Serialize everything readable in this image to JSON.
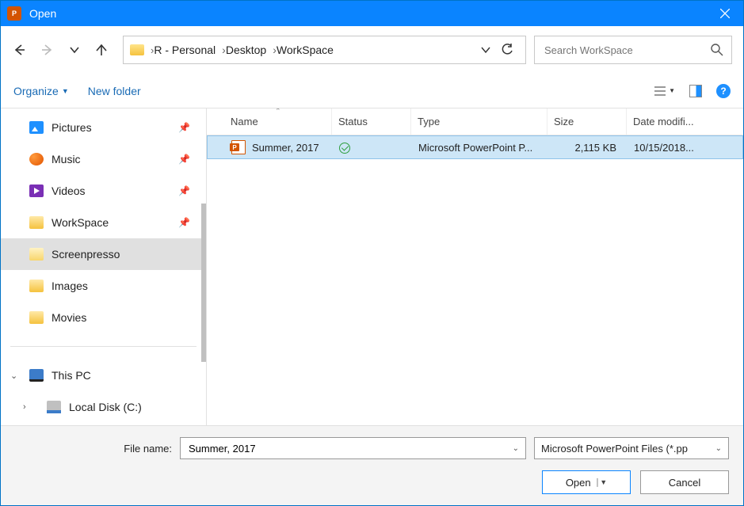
{
  "titlebar": {
    "title": "Open"
  },
  "breadcrumb": {
    "items": [
      "R - Personal",
      "Desktop",
      "WorkSpace"
    ]
  },
  "search": {
    "placeholder": "Search WorkSpace"
  },
  "toolbar": {
    "organize": "Organize",
    "newfolder": "New folder"
  },
  "sidebar": {
    "items": [
      {
        "label": "Pictures",
        "icon": "pictures",
        "pinned": true
      },
      {
        "label": "Music",
        "icon": "music",
        "pinned": true
      },
      {
        "label": "Videos",
        "icon": "videos",
        "pinned": true
      },
      {
        "label": "WorkSpace",
        "icon": "folder",
        "pinned": true
      },
      {
        "label": "Screenpresso",
        "icon": "folder-open",
        "selected": true
      },
      {
        "label": "Images",
        "icon": "folder"
      },
      {
        "label": "Movies",
        "icon": "folder"
      }
    ],
    "thispc": "This PC",
    "localdisk": "Local Disk (C:)"
  },
  "columns": {
    "name": "Name",
    "status": "Status",
    "type": "Type",
    "size": "Size",
    "date": "Date modifi..."
  },
  "files": [
    {
      "name": "Summer, 2017",
      "status": "synced",
      "type": "Microsoft PowerPoint P...",
      "size": "2,115 KB",
      "date": "10/15/2018..."
    }
  ],
  "footer": {
    "filename_label": "File name:",
    "filename_value": "Summer, 2017",
    "filter": "Microsoft PowerPoint Files (*.pp",
    "open": "Open",
    "cancel": "Cancel"
  }
}
